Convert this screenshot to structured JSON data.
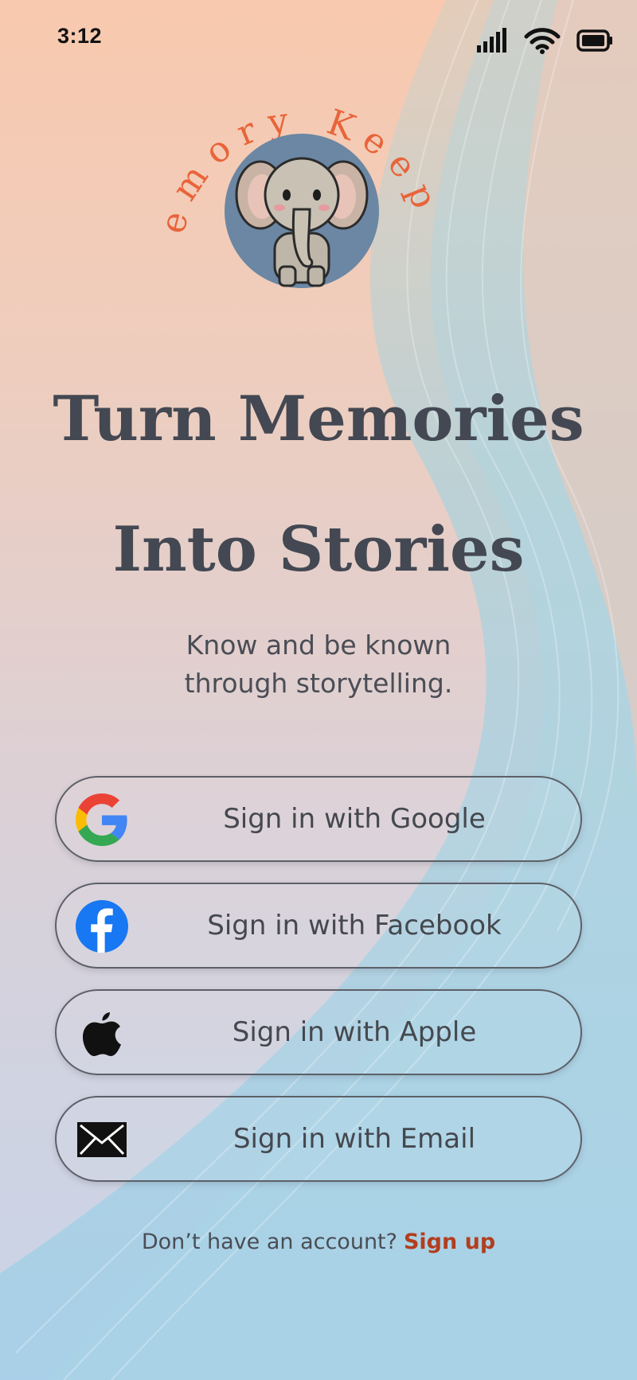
{
  "status_bar": {
    "time": "3:12",
    "icons": [
      "cellular-signal-icon",
      "wifi-icon",
      "battery-icon"
    ]
  },
  "logo": {
    "arc_text": "Memory Keeper",
    "image": "elephant-mascot"
  },
  "headline": {
    "line1": "Turn Memories",
    "line2": "Into Stories"
  },
  "tagline": {
    "line1": "Know and be known",
    "line2": "through storytelling."
  },
  "auth_buttons": [
    {
      "label": "Sign in with Google",
      "icon": "google-icon"
    },
    {
      "label": "Sign in with Facebook",
      "icon": "facebook-icon"
    },
    {
      "label": "Sign in with Apple",
      "icon": "apple-icon"
    },
    {
      "label": "Sign in with Email",
      "icon": "envelope-icon"
    }
  ],
  "signup": {
    "prompt": "Don’t have an account?",
    "link_label": "Sign up"
  },
  "colors": {
    "accent": "#e8643a",
    "signup_link": "#b23e1f",
    "logo_circle": "#6b87a3",
    "headline_text": "#434852",
    "facebook_blue": "#1877f2"
  }
}
